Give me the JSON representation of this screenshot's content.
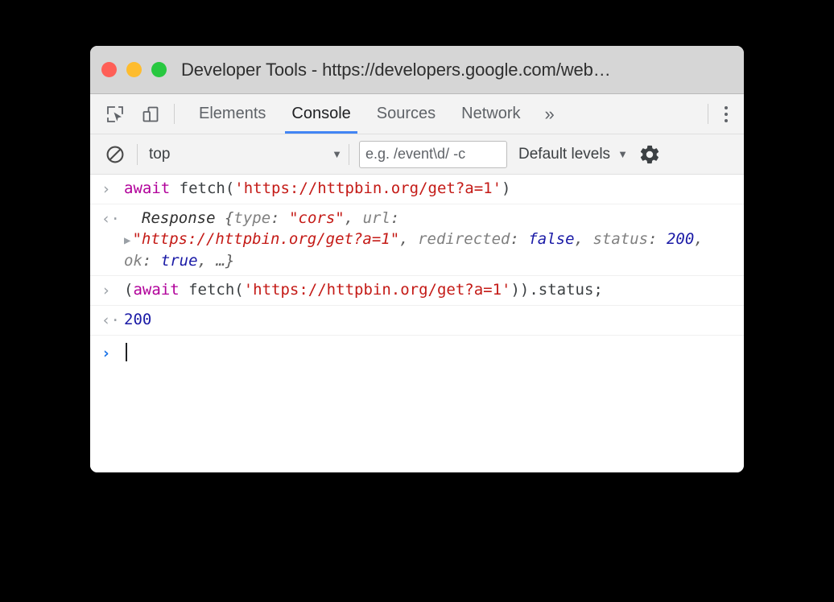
{
  "window": {
    "title": "Developer Tools - https://developers.google.com/web…",
    "traffic_lights": [
      {
        "name": "close",
        "color": "#ff5f57"
      },
      {
        "name": "minimize",
        "color": "#febc2e"
      },
      {
        "name": "maximize",
        "color": "#28c840"
      }
    ]
  },
  "tabbar": {
    "icons": [
      {
        "name": "inspect-element-icon",
        "label": "Inspect element"
      },
      {
        "name": "device-toolbar-icon",
        "label": "Toggle device toolbar"
      }
    ],
    "tabs": [
      {
        "label": "Elements",
        "active": false
      },
      {
        "label": "Console",
        "active": true
      },
      {
        "label": "Sources",
        "active": false
      },
      {
        "label": "Network",
        "active": false
      }
    ],
    "more_label": "»",
    "menu_label": "Customize and control DevTools",
    "active_underline_color": "#4285f4"
  },
  "console_toolbar": {
    "clear_label": "Clear console",
    "context": "top",
    "context_caret": "▼",
    "filter_placeholder": "e.g. /event\\d/ -c",
    "filter_value": "",
    "levels_label": "Default levels",
    "levels_caret": "▼",
    "settings_label": "Console settings"
  },
  "console": {
    "entries": [
      {
        "kind": "input",
        "gutter": "›",
        "tokens": [
          {
            "t": "await",
            "c": "kw"
          },
          {
            "t": " fetch(",
            "c": "plain"
          },
          {
            "t": "'https://httpbin.org/get?a=1'",
            "c": "str"
          },
          {
            "t": ")",
            "c": "plain"
          }
        ]
      },
      {
        "kind": "output",
        "gutter": "‹·",
        "object": {
          "name": "Response",
          "open_brace": " {",
          "triangle": "▶",
          "props": [
            {
              "key": "type",
              "value": "\"cors\"",
              "type": "string"
            },
            {
              "key": "url",
              "value": "\"https://httpbin.org/get?a=1\"",
              "type": "string"
            },
            {
              "key": "redirected",
              "value": "false",
              "type": "boolean"
            },
            {
              "key": "status",
              "value": "200",
              "type": "number"
            },
            {
              "key": "ok",
              "value": "true",
              "type": "boolean"
            }
          ],
          "ellipsis": "…",
          "close_brace": "}"
        }
      },
      {
        "kind": "input",
        "gutter": "›",
        "tokens": [
          {
            "t": "(",
            "c": "plain"
          },
          {
            "t": "await",
            "c": "kw"
          },
          {
            "t": " fetch(",
            "c": "plain"
          },
          {
            "t": "'https://httpbin.org/get?a=1'",
            "c": "str"
          },
          {
            "t": ")).status;",
            "c": "plain"
          }
        ]
      },
      {
        "kind": "output",
        "gutter": "‹·",
        "tokens": [
          {
            "t": "200",
            "c": "num"
          }
        ]
      },
      {
        "kind": "prompt",
        "gutter": "›",
        "value": ""
      }
    ]
  },
  "colors": {
    "accent": "#4285f4",
    "keyword": "#b1009a",
    "string": "#c41a16",
    "number": "#1a1aa6",
    "prompt": "#1a73e8",
    "page_background": "#000000"
  }
}
